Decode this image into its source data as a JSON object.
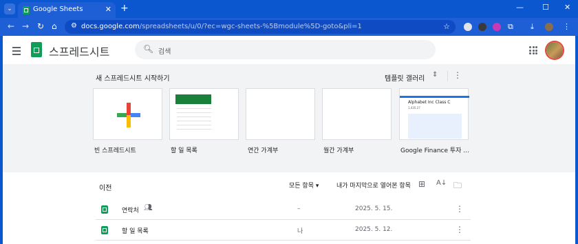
{
  "browser": {
    "tab_title": "Google Sheets",
    "new_tab": "+",
    "url_host": "docs.google.com",
    "url_path": "/spreadsheets/u/0/?ec=wgc-sheets-%5Bmodule%5D-goto&pli=1",
    "window": {
      "minimize": "—",
      "maximize": "☐",
      "close": "✕"
    }
  },
  "app": {
    "title": "스프레드시트",
    "search_placeholder": "검색"
  },
  "start": {
    "heading": "새 스프레드시트 시작하기",
    "gallery_label": "템플릿 갤러리",
    "templates": [
      {
        "label": "빈 스프레드시트"
      },
      {
        "label": "할 일 목록"
      },
      {
        "label": "연간 가계부"
      },
      {
        "label": "월간 가계부"
      },
      {
        "label": "Google Finance 투자 ..."
      }
    ],
    "finance_preview": {
      "title": "Alphabet Inc Class C",
      "number": "1,435.27"
    }
  },
  "recent": {
    "heading": "이전",
    "owner_filter": "모든 항목",
    "sort_label": "내가 마지막으로 열어본 항목",
    "files": [
      {
        "name": "연락처",
        "owner": "–",
        "date": "2025. 5. 15."
      },
      {
        "name": "할 일 목록",
        "owner": "나",
        "date": "2025. 5. 12."
      }
    ]
  },
  "colors": {
    "chrome_blue": "#0b57d0",
    "sheets_green": "#0f9d58",
    "page_gray": "#f1f3f4"
  }
}
